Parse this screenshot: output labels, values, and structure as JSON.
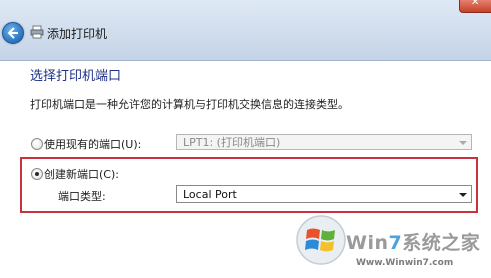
{
  "window": {
    "title": "添加打印机",
    "close_glyph": "✕"
  },
  "page": {
    "heading": "选择打印机端口",
    "description": "打印机端口是一种允许您的计算机与打印机交换信息的连接类型。"
  },
  "options": {
    "existing_port": {
      "label": "使用现有的端口(U):",
      "selected": false,
      "value": "LPT1: (打印机端口)"
    },
    "new_port": {
      "label": "创建新端口(C):",
      "selected": true
    },
    "port_type": {
      "label": "端口类型:",
      "value": "Local Port"
    }
  },
  "watermark": {
    "brand_win": "Win",
    "brand_7": "7",
    "brand_rest": "系统之家",
    "url": "Www.Winwin7.com"
  },
  "colors": {
    "heading": "#1e3287",
    "highlight": "#c9313c",
    "titlebar": "#cfdcec"
  }
}
